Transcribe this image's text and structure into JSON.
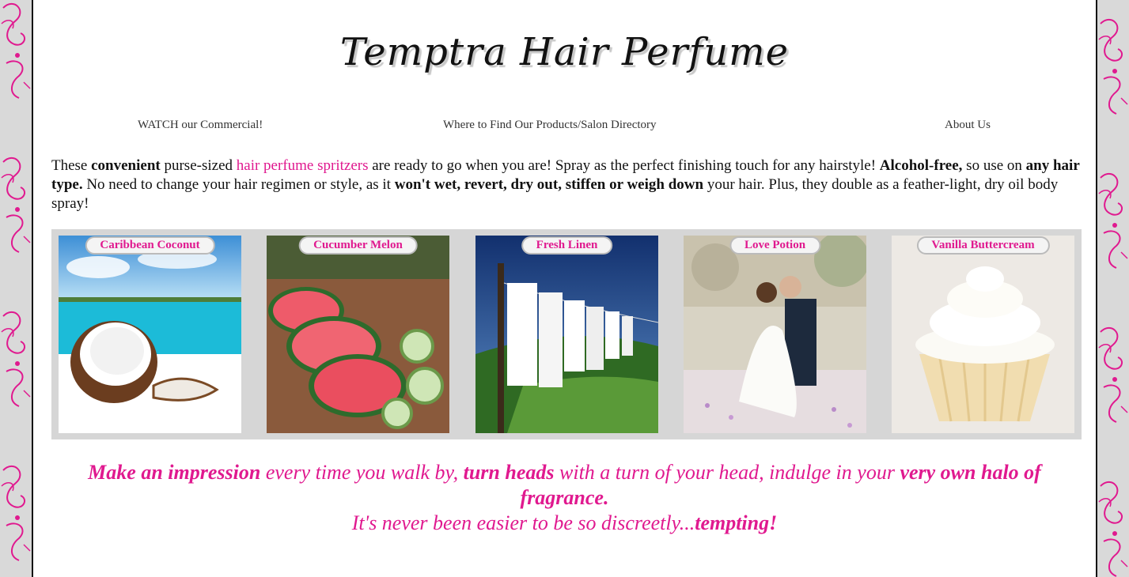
{
  "site": {
    "title": "Temptra Hair Perfume"
  },
  "nav": {
    "commercial": "WATCH our Commercial!",
    "directory": "Where to Find Our Products/Salon Directory",
    "about": "About Us"
  },
  "intro": {
    "p1": "These ",
    "b1": "convenient",
    "p2": " purse-sized ",
    "link": "hair perfume spritzers",
    "p3": " are ready to go when you are! Spray as the perfect finishing touch for any hairstyle! ",
    "b2": "Alcohol-free,",
    "p4": " so use on ",
    "b3": "any hair type.",
    "p5": " No need to change your hair regimen or style, as it ",
    "b4": "won't wet, revert, dry out, stiffen or weigh down",
    "p6": " your hair. Plus, they double as a feather-light, dry oil body spray!"
  },
  "scents": [
    {
      "label": "Caribbean Coconut"
    },
    {
      "label": "Cucumber Melon"
    },
    {
      "label": "Fresh Linen"
    },
    {
      "label": "Love Potion"
    },
    {
      "label": "Vanilla Buttercream"
    }
  ],
  "tagline": {
    "b1": "Make an impression",
    "t1": " every time you walk by, ",
    "b2": "turn heads",
    "t2": " with a turn of your head, indulge in your ",
    "b3": "very own halo of fragrance.",
    "t3": "It's never been easier to be so discreetly...",
    "b4": "tempting!"
  },
  "colors": {
    "accent": "#e0198f",
    "background": "#d9d9d9",
    "page": "#ffffff"
  }
}
